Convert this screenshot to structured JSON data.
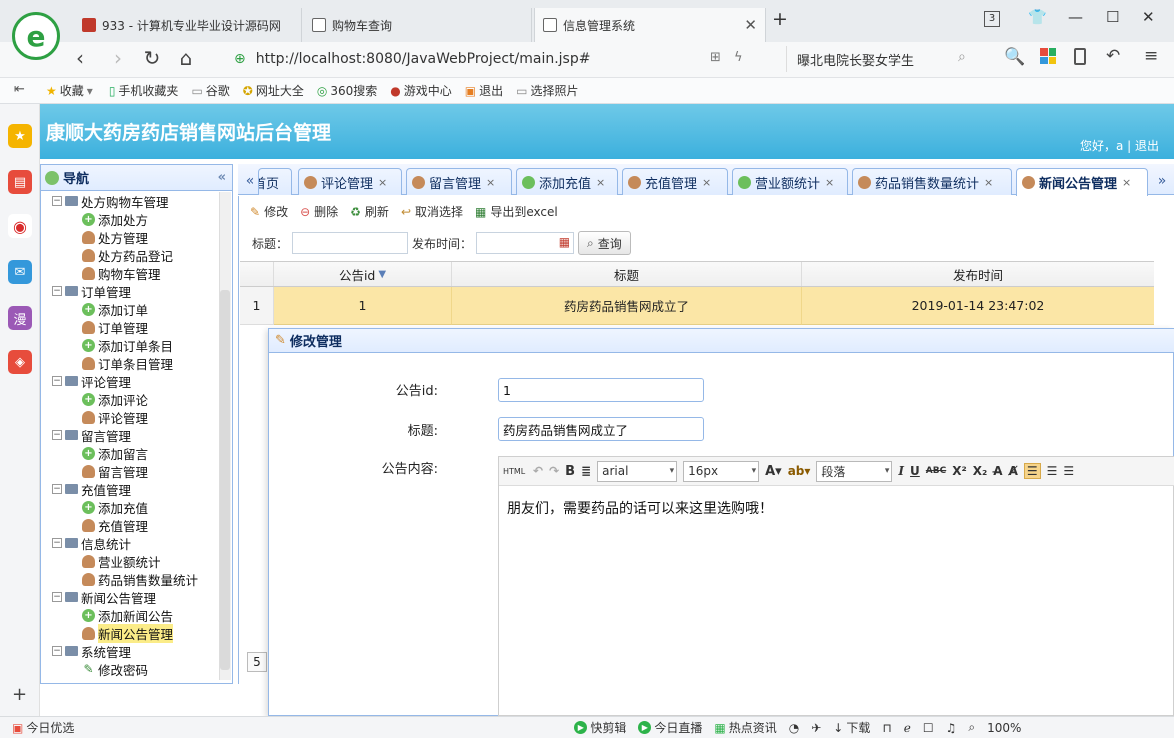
{
  "browser": {
    "tabs": [
      {
        "label": "933 - 计算机专业毕业设计源码网",
        "active": false
      },
      {
        "label": "购物车查询",
        "active": false
      },
      {
        "label": "信息管理系统",
        "active": true
      }
    ],
    "tab_counter": "3",
    "url": "http://localhost:8080/JavaWebProject/main.jsp#",
    "search_value": "曝北电院长娶女学生",
    "bookmarks": [
      "收藏",
      "手机收藏夹",
      "谷歌",
      "网址大全",
      "360搜索",
      "游戏中心",
      "退出",
      "选择照片"
    ]
  },
  "app": {
    "title": "康顺大药房药店销售网站后台管理",
    "greeting": "您好，a | 退出"
  },
  "sidebar": {
    "title": "导航",
    "collapse": "«",
    "groups": [
      {
        "label": "处方购物车管理",
        "children": [
          "添加处方",
          "处方管理",
          "处方药品登记",
          "购物车管理"
        ]
      },
      {
        "label": "订单管理",
        "children": [
          "添加订单",
          "订单管理",
          "添加订单条目",
          "订单条目管理"
        ]
      },
      {
        "label": "评论管理",
        "children": [
          "添加评论",
          "评论管理"
        ]
      },
      {
        "label": "留言管理",
        "children": [
          "添加留言",
          "留言管理"
        ]
      },
      {
        "label": "充值管理",
        "children": [
          "添加充值",
          "充值管理"
        ]
      },
      {
        "label": "信息统计",
        "children": [
          "营业额统计",
          "药品销售数量统计"
        ]
      },
      {
        "label": "新闻公告管理",
        "children": [
          "添加新闻公告",
          "新闻公告管理"
        ]
      },
      {
        "label": "系统管理",
        "children": [
          "修改密码"
        ]
      }
    ],
    "selected": "新闻公告管理"
  },
  "tabs": {
    "left_arrow": "«",
    "right_arrow": "»",
    "items": [
      "首页",
      "评论管理",
      "留言管理",
      "添加充值",
      "充值管理",
      "营业额统计",
      "药品销售数量统计",
      "新闻公告管理"
    ],
    "first_visible": "首页",
    "active": "新闻公告管理",
    "close": "×"
  },
  "toolbar": {
    "edit": "修改",
    "delete": "删除",
    "refresh": "刷新",
    "cancel_select": "取消选择",
    "export": "导出到excel"
  },
  "filter": {
    "title_label": "标题：",
    "date_label": "发布时间：",
    "query": "查询"
  },
  "grid": {
    "columns": [
      "公告id",
      "标题",
      "发布时间"
    ],
    "rows": [
      {
        "num": "1",
        "id": "1",
        "title": "药房药品销售网成立了",
        "time": "2019-01-14 23:47:02"
      }
    ],
    "pager_page": "5"
  },
  "dialog": {
    "title": "修改管理",
    "fields": {
      "id_label": "公告id:",
      "id_value": "1",
      "title_label": "标题:",
      "title_value": "药房药品销售网成立了",
      "content_label": "公告内容:"
    },
    "editor": {
      "html_btn": "HTML",
      "font_family": "arial",
      "font_size": "16px",
      "paragraph": "段落",
      "content": "朋友们，需要药品的话可以来这里选购哦！"
    }
  },
  "statusbar": {
    "items": [
      "今日优选",
      "快剪辑",
      "今日直播",
      "热点资讯",
      "下载",
      "100%"
    ]
  },
  "colors": {
    "header_blue": "#3cb0dd",
    "easyui_border": "#95b8e7",
    "row_selected": "#fbe6a6"
  }
}
